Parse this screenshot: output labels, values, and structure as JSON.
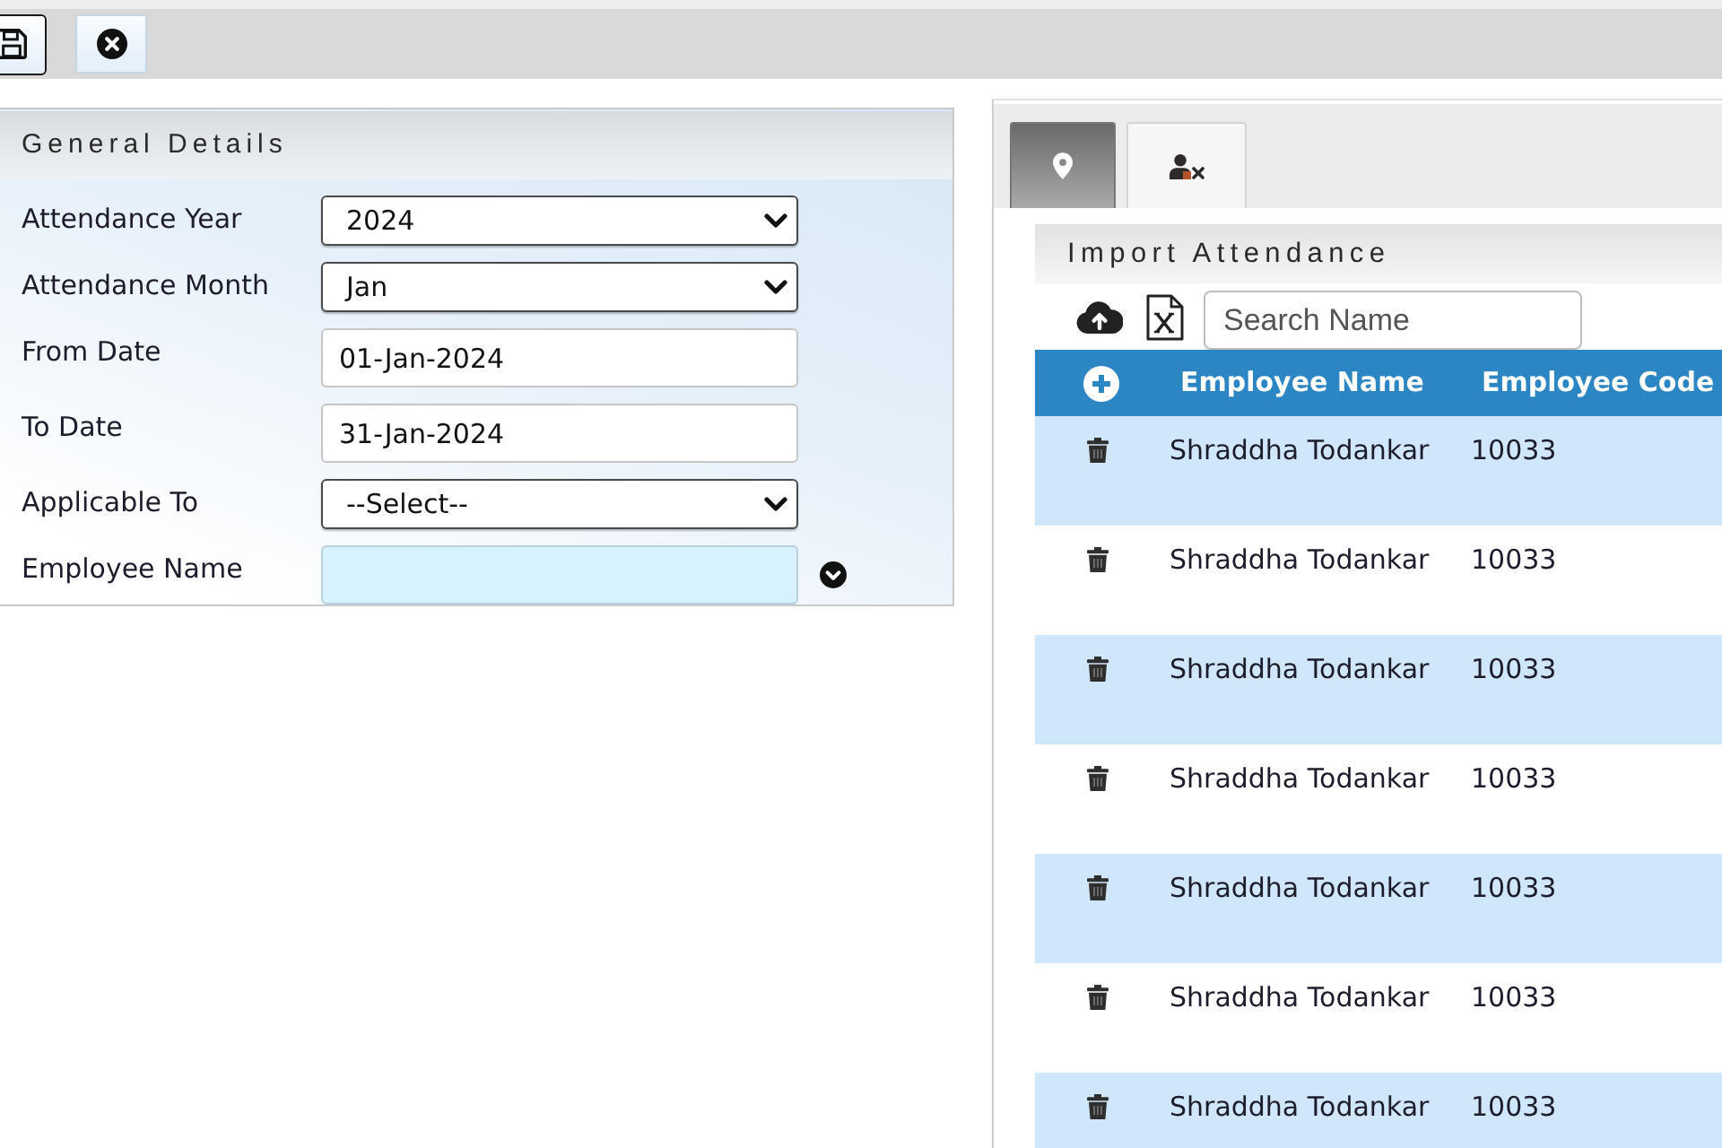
{
  "toolbar": [
    {
      "kind": "save"
    },
    {
      "kind": "close"
    }
  ],
  "general_details": {
    "title": "General Details",
    "fields": [
      {
        "label": "Attendance Year",
        "kind": "select",
        "value": "2024"
      },
      {
        "label": "Attendance Month",
        "kind": "select",
        "value": "Jan"
      },
      {
        "label": "From Date",
        "kind": "text",
        "value": "01-Jan-2024"
      },
      {
        "label": "To Date",
        "kind": "text",
        "value": "31-Jan-2024"
      },
      {
        "label": "Applicable To",
        "kind": "select",
        "value": "--Select--"
      },
      {
        "label": "Employee Name",
        "kind": "lookup"
      }
    ]
  },
  "tabs": [
    {
      "kind": "location",
      "selected": true
    },
    {
      "kind": "remove_user",
      "selected": false
    }
  ],
  "import_attendance": {
    "title": "Import Attendance",
    "tools": [
      {
        "kind": "upload"
      },
      {
        "kind": "spreadsheet"
      }
    ],
    "search": {
      "placeholder": "Search Name"
    },
    "table": {
      "columns": [
        "Employee Name",
        "Employee Code"
      ],
      "rows": [
        {
          "employee_name": "Shraddha Todankar",
          "employee_code": "10033"
        },
        {
          "employee_name": "Shraddha Todankar",
          "employee_code": "10033"
        },
        {
          "employee_name": "Shraddha Todankar",
          "employee_code": "10033"
        },
        {
          "employee_name": "Shraddha Todankar",
          "employee_code": "10033"
        },
        {
          "employee_name": "Shraddha Todankar",
          "employee_code": "10033"
        },
        {
          "employee_name": "Shraddha Todankar",
          "employee_code": "10033"
        },
        {
          "employee_name": "Shraddha Todankar",
          "employee_code": "10033"
        }
      ]
    }
  }
}
